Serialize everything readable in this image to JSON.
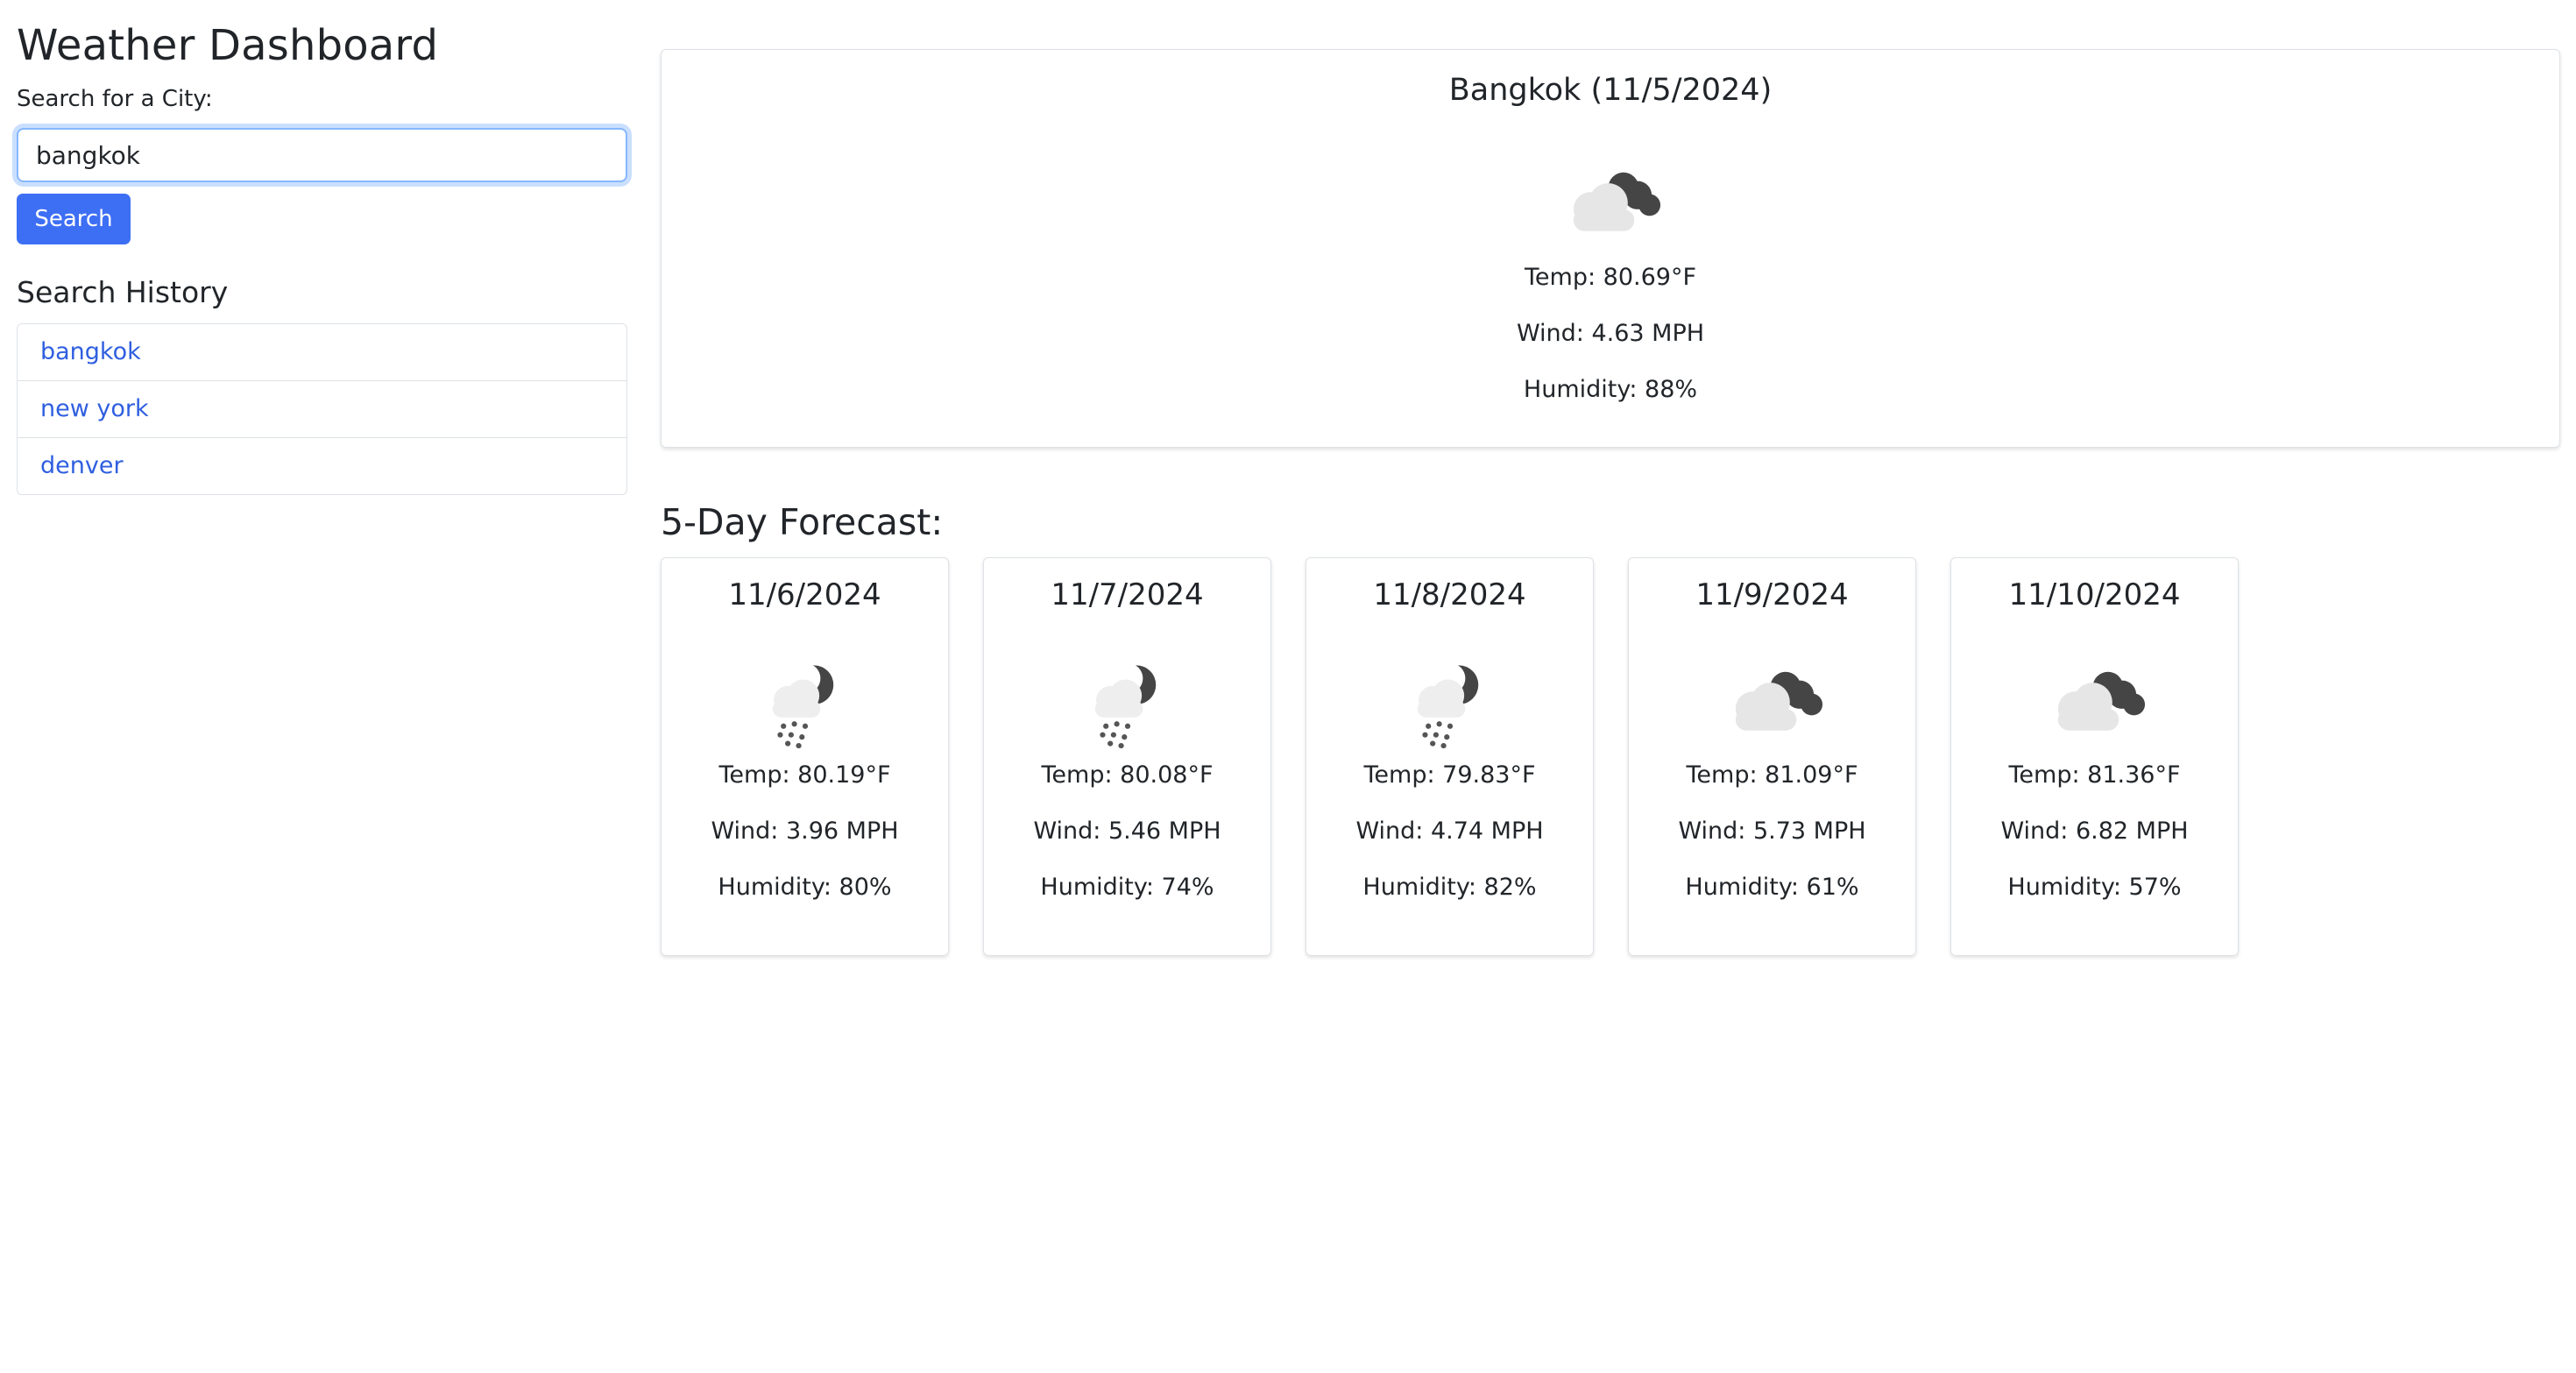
{
  "app_title": "Weather Dashboard",
  "search": {
    "label": "Search for a City:",
    "value": "bangkok",
    "button_label": "Search"
  },
  "history": {
    "title": "Search History",
    "items": [
      "bangkok",
      "new york",
      "denver"
    ]
  },
  "current": {
    "title": "Bangkok (11/5/2024)",
    "icon": "cloudy-night-icon",
    "temp": "Temp: 80.69°F",
    "wind": "Wind: 4.63 MPH",
    "humidity": "Humidity: 88%"
  },
  "forecast": {
    "title": "5-Day Forecast:",
    "days": [
      {
        "date": "11/6/2024",
        "icon": "rain-night-icon",
        "temp": "Temp: 80.19°F",
        "wind": "Wind: 3.96 MPH",
        "humidity": "Humidity: 80%"
      },
      {
        "date": "11/7/2024",
        "icon": "rain-night-icon",
        "temp": "Temp: 80.08°F",
        "wind": "Wind: 5.46 MPH",
        "humidity": "Humidity: 74%"
      },
      {
        "date": "11/8/2024",
        "icon": "rain-night-icon",
        "temp": "Temp: 79.83°F",
        "wind": "Wind: 4.74 MPH",
        "humidity": "Humidity: 82%"
      },
      {
        "date": "11/9/2024",
        "icon": "cloudy-night-icon",
        "temp": "Temp: 81.09°F",
        "wind": "Wind: 5.73 MPH",
        "humidity": "Humidity: 61%"
      },
      {
        "date": "11/10/2024",
        "icon": "cloudy-night-icon",
        "temp": "Temp: 81.36°F",
        "wind": "Wind: 6.82 MPH",
        "humidity": "Humidity: 57%"
      }
    ]
  },
  "colors": {
    "accent": "#3d6ff5",
    "link": "#2f5fe0",
    "border": "#dee2e6",
    "text": "#212529"
  }
}
